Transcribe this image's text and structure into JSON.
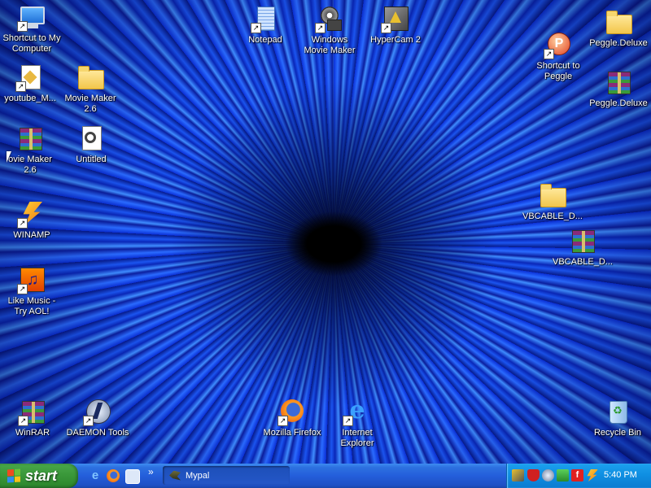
{
  "desktop": {
    "icons": {
      "my_computer": "Shortcut to My\nComputer",
      "youtube": "youtube_M...",
      "movie_maker_folder": "Movie Maker\n2.6",
      "movie_maker_rar": "ovie Maker\n2.6",
      "untitled": "Untitled",
      "winamp": "WINAMP",
      "like_music": "Like Music -\nTry AOL!",
      "winrar": "WinRAR",
      "daemon": "DAEMON Tools",
      "notepad": "Notepad",
      "windows_movie_maker": "Windows\nMovie Maker",
      "hypercam": "HyperCam 2",
      "firefox": "Mozilla Firefox",
      "ie": "Internet\nExplorer",
      "shortcut_peggle": "Shortcut to\nPeggle",
      "peggle_folder": "Peggle.Deluxe",
      "peggle_rar": "Peggle.Deluxe",
      "vbcable_folder": "VBCABLE_D...",
      "vbcable_rar": "VBCABLE_D...",
      "recycle_bin": "Recycle Bin"
    }
  },
  "taskbar": {
    "start_label": "start",
    "quick_launch_more": "»",
    "task_label": "Mypal",
    "clock": "5:40 PM"
  },
  "colors": {
    "taskbar_blue": "#245edb",
    "start_green": "#3c9a3c",
    "tray_blue": "#0f8fe2"
  }
}
